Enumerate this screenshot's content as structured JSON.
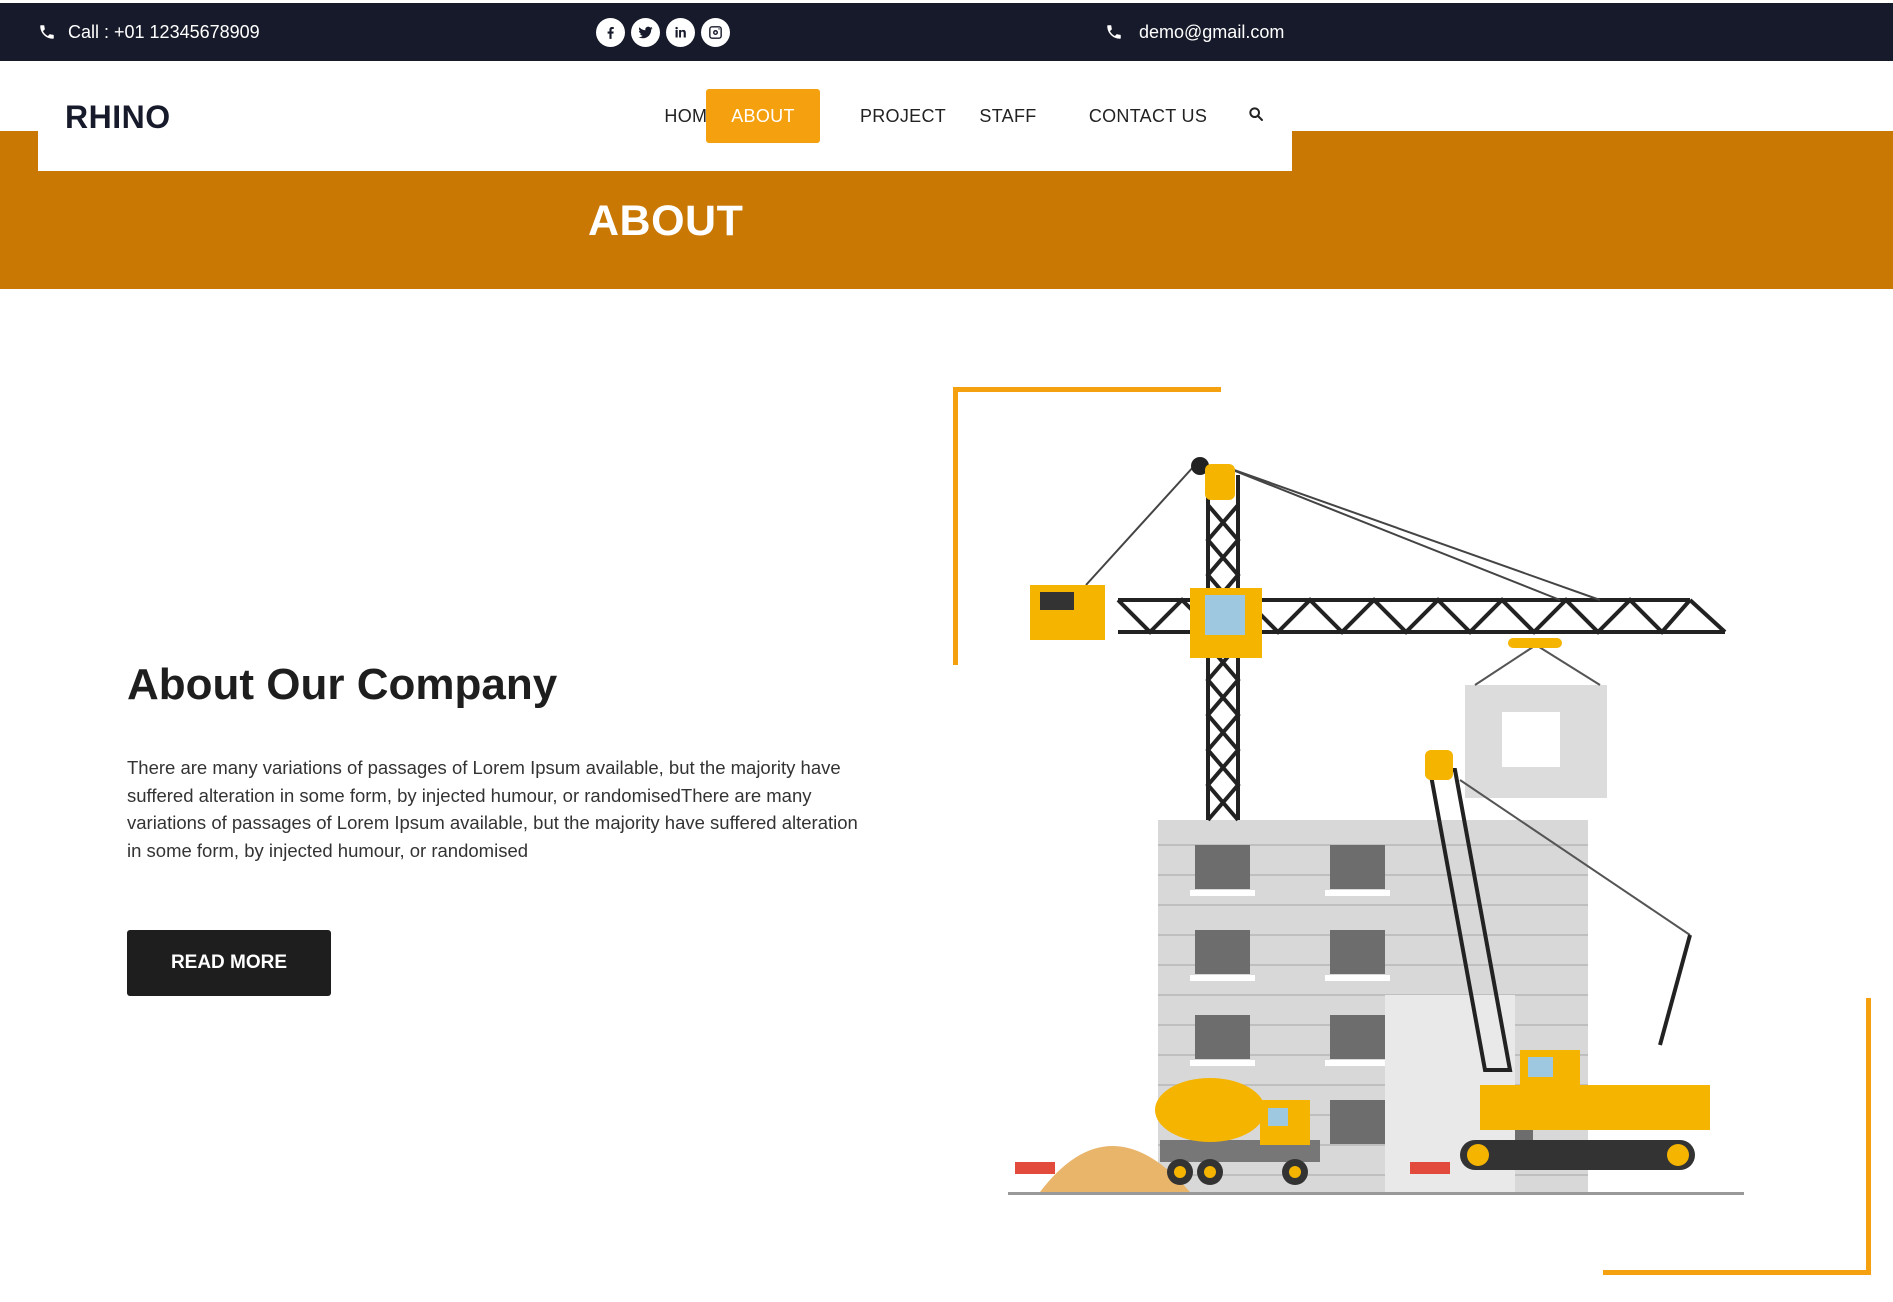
{
  "topbar": {
    "phone_text": "Call : +01 12345678909",
    "email_text": "demo@gmail.com",
    "social": [
      "facebook-icon",
      "twitter-icon",
      "linkedin-icon",
      "instagram-icon"
    ]
  },
  "nav": {
    "logo": "RHINO",
    "items": [
      {
        "label": "HOME",
        "active": false
      },
      {
        "label": "ABOUT",
        "active": true
      },
      {
        "label": "PROJECT",
        "active": false
      },
      {
        "label": "STAFF",
        "active": false
      },
      {
        "label": "CONTACT US",
        "active": false
      }
    ],
    "search_icon": "search-icon"
  },
  "banner": {
    "title": "ABOUT"
  },
  "about": {
    "heading": "About Our Company",
    "paragraph": "There are many variations of passages of Lorem Ipsum available, but the majority have suffered alteration in some form, by injected humour, or randomisedThere are many variations of passages of Lorem Ipsum available, but the majority have suffered alteration in some form, by injected humour, or randomised",
    "button_label": "READ MORE"
  },
  "colors": {
    "topbar_bg": "#171a2a",
    "band_bg": "#c97803",
    "accent": "#f5a00e",
    "button_bg": "#1e1e1e"
  },
  "illustration": {
    "description_icon": "construction-illustration"
  }
}
